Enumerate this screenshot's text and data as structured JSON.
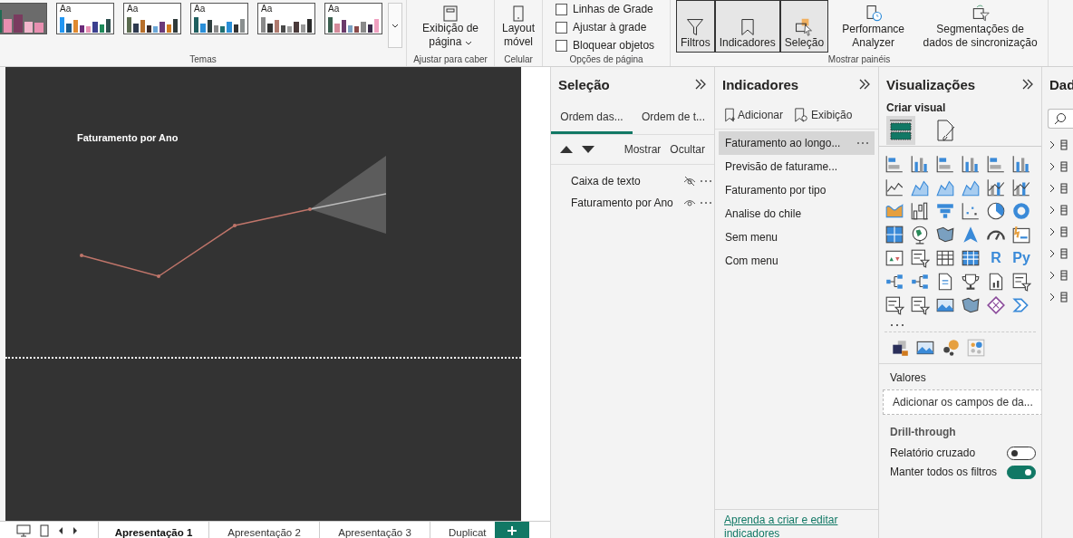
{
  "ribbon": {
    "themes": {
      "items": [
        {
          "kind": "dark",
          "bars": [
            {
              "color": "#1f6b52"
            },
            {
              "color": "#e88fb0"
            },
            {
              "color": "#7a3b5f"
            },
            {
              "color": "#f2b6cc"
            },
            {
              "color": "#e88fb0"
            }
          ]
        },
        {
          "kind": "light",
          "label": "Aa",
          "bars": [
            {
              "color": "#2196f3"
            },
            {
              "color": "#1b5a8a"
            },
            {
              "color": "#e08a2e"
            },
            {
              "color": "#6b2c7a"
            },
            {
              "color": "#e78fb3"
            },
            {
              "color": "#3b3f8f"
            },
            {
              "color": "#1e8a5a"
            },
            {
              "color": "#2f4f4f"
            }
          ]
        },
        {
          "kind": "light",
          "label": "Aa",
          "bars": [
            {
              "color": "#5a6b4f"
            },
            {
              "color": "#2e3a4f"
            },
            {
              "color": "#b86f2a"
            },
            {
              "color": "#3a2a2a"
            },
            {
              "color": "#6aa6d6"
            },
            {
              "color": "#6b3a7a"
            },
            {
              "color": "#d07a1e"
            },
            {
              "color": "#2f3a3a"
            }
          ]
        },
        {
          "kind": "light",
          "label": "Aa",
          "bars": [
            {
              "color": "#1f5f5f"
            },
            {
              "color": "#2a8fd8"
            },
            {
              "color": "#2f3f3f"
            },
            {
              "color": "#8a8a8a"
            },
            {
              "color": "#1f6f6f"
            },
            {
              "color": "#2a8fd8"
            },
            {
              "color": "#333333"
            },
            {
              "color": "#8a8f8f"
            }
          ]
        },
        {
          "kind": "light",
          "label": "Aa",
          "bars": [
            {
              "color": "#8a8a8a"
            },
            {
              "color": "#333333"
            },
            {
              "color": "#b07a6e"
            },
            {
              "color": "#4a4a4a"
            },
            {
              "color": "#9a9a9a"
            },
            {
              "color": "#4a3a3a"
            },
            {
              "color": "#9a9a9a"
            },
            {
              "color": "#2a2a2a"
            }
          ]
        },
        {
          "kind": "light",
          "label": "Aa",
          "bars": [
            {
              "color": "#3a5f4f"
            },
            {
              "color": "#d48a9a"
            },
            {
              "color": "#6a3a6a"
            },
            {
              "color": "#7aa0c0"
            },
            {
              "color": "#8a4a4a"
            },
            {
              "color": "#8a8a8a"
            },
            {
              "color": "#3a2a4a"
            },
            {
              "color": "#f0a0c0"
            }
          ]
        }
      ],
      "group_label": "Temas"
    },
    "page_view": {
      "label": "Exibição de página",
      "group_label": "Ajustar para caber"
    },
    "mobile": {
      "label": "Layout móvel",
      "group_label": "Celular"
    },
    "page_options": {
      "checkboxes": [
        {
          "label": "Linhas de Grade",
          "checked": false
        },
        {
          "label": "Ajustar à grade",
          "checked": false
        },
        {
          "label": "Bloquear objetos",
          "checked": false
        }
      ],
      "group_label": "Opções de página"
    },
    "show_panes": {
      "buttons": [
        {
          "kind": "filter",
          "label": "Filtros",
          "selected": true
        },
        {
          "kind": "bookmark",
          "label": "Indicadores",
          "selected": true
        },
        {
          "kind": "selection",
          "label": "Seleção",
          "selected": true
        },
        {
          "kind": "performance",
          "label": "Performance Analyzer",
          "selected": false
        },
        {
          "kind": "sync",
          "label": "Segmentações de dados de sincronização",
          "selected": false
        }
      ],
      "group_label": "Mostrar painéis"
    }
  },
  "report": {
    "chart": {
      "title": "Faturamento por Ano"
    }
  },
  "page_tabs": [
    {
      "label": "Apresentação 1",
      "selected": true
    },
    {
      "label": "Apresentação 2",
      "selected": false
    },
    {
      "label": "Apresentação 3",
      "selected": false
    },
    {
      "label": "Duplicat",
      "selected": false
    }
  ],
  "selection_pane": {
    "title": "Seleção",
    "tabs": [
      {
        "label": "Ordem das...",
        "selected": true
      },
      {
        "label": "Ordem de t...",
        "selected": false
      }
    ],
    "actions": [
      "Mostrar",
      "Ocultar"
    ],
    "items": [
      {
        "label": "Caixa de texto",
        "visible": false
      },
      {
        "label": "Faturamento por Ano",
        "visible": true
      }
    ]
  },
  "bookmarks_pane": {
    "title": "Indicadores",
    "toolbar": [
      {
        "kind": "add",
        "label": "Adicionar"
      },
      {
        "kind": "view",
        "label": "Exibição"
      }
    ],
    "items": [
      {
        "label": "Faturamento ao longo...",
        "selected": true
      },
      {
        "label": "Previsão de faturame...",
        "selected": false
      },
      {
        "label": "Faturamento por tipo",
        "selected": false
      },
      {
        "label": "Analise do chile",
        "selected": false
      },
      {
        "label": "Sem menu",
        "selected": false
      },
      {
        "label": "Com menu",
        "selected": false
      }
    ],
    "link": "Aprenda a criar e editar indicadores"
  },
  "visualizations_pane": {
    "title": "Visualizações",
    "subtitle": "Criar visual",
    "modes": [
      {
        "kind": "build",
        "selected": true
      },
      {
        "kind": "format",
        "selected": false
      }
    ],
    "visuals": [
      {
        "kind": "hbar"
      },
      {
        "kind": "vbar"
      },
      {
        "kind": "hbar"
      },
      {
        "kind": "vbar"
      },
      {
        "kind": "hbar"
      },
      {
        "kind": "vbar"
      },
      {
        "kind": "line"
      },
      {
        "kind": "area"
      },
      {
        "kind": "area"
      },
      {
        "kind": "area"
      },
      {
        "kind": "combo"
      },
      {
        "kind": "combo"
      },
      {
        "kind": "ribbon"
      },
      {
        "kind": "waterfall"
      },
      {
        "kind": "funnel"
      },
      {
        "kind": "scatter"
      },
      {
        "kind": "pie"
      },
      {
        "kind": "donut"
      },
      {
        "kind": "treemap"
      },
      {
        "kind": "globe"
      },
      {
        "kind": "map"
      },
      {
        "kind": "arrow"
      },
      {
        "kind": "gauge"
      },
      {
        "kind": "card"
      },
      {
        "kind": "kpi"
      },
      {
        "kind": "slicer"
      },
      {
        "kind": "table"
      },
      {
        "kind": "matrix"
      },
      {
        "kind": "text",
        "label": "R"
      },
      {
        "kind": "text",
        "label": "Py"
      },
      {
        "kind": "tree"
      },
      {
        "kind": "tree"
      },
      {
        "kind": "doc"
      },
      {
        "kind": "trophy"
      },
      {
        "kind": "report"
      },
      {
        "kind": "slicer"
      },
      {
        "kind": "slicer"
      },
      {
        "kind": "slicer"
      },
      {
        "kind": "image"
      },
      {
        "kind": "map"
      },
      {
        "kind": "diamond"
      },
      {
        "kind": "chevron"
      }
    ],
    "more_visuals": [
      {
        "kind": "layers"
      },
      {
        "kind": "image"
      },
      {
        "kind": "bubbles"
      },
      {
        "kind": "dots"
      }
    ],
    "values": {
      "label": "Valores",
      "drop_zone_text": "Adicionar os campos de da..."
    },
    "drillthrough": {
      "title": "Drill-through",
      "toggles": [
        {
          "label": "Relatório cruzado",
          "on": false
        },
        {
          "label": "Manter todos os filtros",
          "on": true
        }
      ]
    }
  },
  "data_pane": {
    "title": "Dad"
  }
}
